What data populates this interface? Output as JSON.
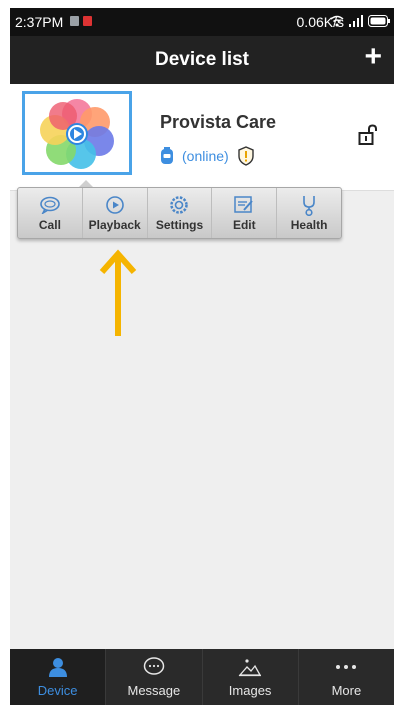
{
  "status_bar": {
    "time": "2:37PM",
    "speed": "0.06K/s"
  },
  "header": {
    "title": "Device list",
    "add_label": "+"
  },
  "device": {
    "name": "Provista Care",
    "status": "(online)"
  },
  "toolbar": {
    "items": [
      {
        "label": "Call",
        "icon": "chat-bubble-icon"
      },
      {
        "label": "Playback",
        "icon": "play-circle-icon"
      },
      {
        "label": "Settings",
        "icon": "gear-icon"
      },
      {
        "label": "Edit",
        "icon": "edit-icon"
      },
      {
        "label": "Health",
        "icon": "stethoscope-icon"
      }
    ]
  },
  "bottom_nav": {
    "tabs": [
      {
        "label": "Device",
        "icon": "person-icon",
        "active": true
      },
      {
        "label": "Message",
        "icon": "message-icon",
        "active": false
      },
      {
        "label": "Images",
        "icon": "image-icon",
        "active": false
      },
      {
        "label": "More",
        "icon": "more-dots-icon",
        "active": false
      }
    ]
  },
  "colors": {
    "accent": "#3d8ee0",
    "annotation_arrow": "#f5b400",
    "title_bar": "#222222"
  }
}
